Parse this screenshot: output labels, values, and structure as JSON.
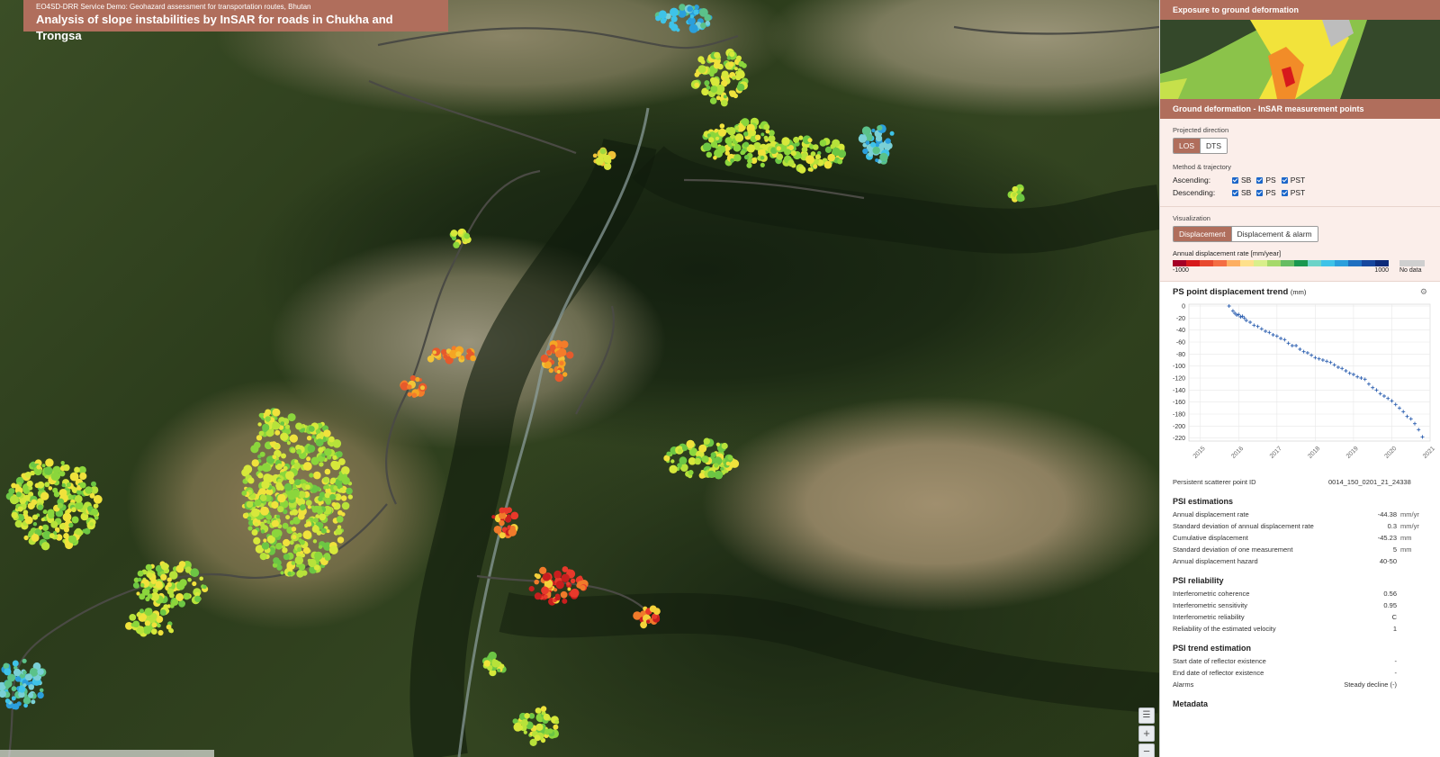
{
  "map": {
    "subtitle": "EO4SD-DRR Service Demo: Geohazard assessment for transportation routes, Bhutan",
    "title": "Analysis of slope instabilities by InSAR for roads in Chukha and Trongsa",
    "zoom_in": "+",
    "zoom_out": "−",
    "layers_icon": "layers-icon"
  },
  "panel": {
    "exposure_header": "Exposure to ground deformation",
    "deformation_header": "Ground deformation - InSAR measurement points",
    "projected_direction_label": "Projected direction",
    "direction_options": [
      "LOS",
      "DTS"
    ],
    "direction_selected": "LOS",
    "method_label": "Method & trajectory",
    "ascending_label": "Ascending:",
    "descending_label": "Descending:",
    "methods": [
      "SB",
      "PS",
      "PST"
    ],
    "visualization_label": "Visualization",
    "viz_options": [
      "Displacement",
      "Displacement & alarm"
    ],
    "viz_selected": "Displacement",
    "scale_label": "Annual displacement rate [mm/year]",
    "scale_min": "-1000",
    "scale_max": "1000",
    "no_data": "No data",
    "scale_colors": [
      "#a50026",
      "#d7191c",
      "#e8492e",
      "#f46d43",
      "#fdae61",
      "#fee08b",
      "#d9ef8b",
      "#a6d96a",
      "#66bd63",
      "#1a9850",
      "#6bd3c8",
      "#3ec3e8",
      "#2b9fdc",
      "#1f6fc0",
      "#17479e",
      "#0c2a78"
    ],
    "plot_title": "PS point displacement trend",
    "plot_unit": "(mm)",
    "plot_icon": "settings-icon"
  },
  "chart_data": {
    "type": "scatter",
    "title": "PS point displacement trend",
    "ylabel": "(mm)",
    "x_ticks": [
      "2015",
      "2016",
      "2017",
      "2018",
      "2019",
      "2020",
      "2021"
    ],
    "y_ticks": [
      0,
      -20,
      -40,
      -60,
      -80,
      -100,
      -120,
      -140,
      -160,
      -180,
      -200,
      -220
    ],
    "xlim": [
      2014.7,
      2021.0
    ],
    "ylim": [
      -225,
      3
    ],
    "x": [
      2015.75,
      2015.85,
      2015.9,
      2015.95,
      2016.0,
      2016.05,
      2016.1,
      2016.15,
      2016.2,
      2016.3,
      2016.4,
      2016.5,
      2016.6,
      2016.7,
      2016.8,
      2016.9,
      2017.0,
      2017.1,
      2017.2,
      2017.3,
      2017.4,
      2017.5,
      2017.6,
      2017.7,
      2017.8,
      2017.9,
      2018.0,
      2018.1,
      2018.2,
      2018.3,
      2018.4,
      2018.5,
      2018.6,
      2018.7,
      2018.8,
      2018.9,
      2019.0,
      2019.1,
      2019.2,
      2019.3,
      2019.4,
      2019.5,
      2019.6,
      2019.7,
      2019.8,
      2019.9,
      2020.0,
      2020.1,
      2020.2,
      2020.3,
      2020.4,
      2020.5,
      2020.6,
      2020.7,
      2020.8
    ],
    "y": [
      0,
      -8,
      -12,
      -15,
      -14,
      -18,
      -17,
      -20,
      -24,
      -27,
      -32,
      -34,
      -38,
      -42,
      -44,
      -48,
      -50,
      -54,
      -56,
      -62,
      -66,
      -66,
      -72,
      -76,
      -78,
      -82,
      -86,
      -88,
      -90,
      -92,
      -94,
      -98,
      -102,
      -104,
      -108,
      -112,
      -114,
      -118,
      -120,
      -122,
      -130,
      -136,
      -140,
      -146,
      -150,
      -154,
      -158,
      -164,
      -170,
      -176,
      -184,
      -188,
      -196,
      -206,
      -218
    ]
  },
  "ps_info": {
    "id_label": "Persistent scatterer point ID",
    "id_value": "0014_150_0201_21_24338"
  },
  "psi_estimations": {
    "title": "PSI estimations",
    "rows": [
      {
        "k": "Annual displacement rate",
        "v": "-44.38",
        "u": "mm/yr"
      },
      {
        "k": "Standard deviation of annual displacement rate",
        "v": "0.3",
        "u": "mm/yr"
      },
      {
        "k": "Cumulative displacement",
        "v": "-45.23",
        "u": "mm"
      },
      {
        "k": "Standard deviation of one measurement",
        "v": "5",
        "u": "mm"
      },
      {
        "k": "Annual displacement hazard",
        "v": "40-50",
        "u": ""
      }
    ]
  },
  "psi_reliability": {
    "title": "PSI reliability",
    "rows": [
      {
        "k": "Interferometric coherence",
        "v": "0.56",
        "u": ""
      },
      {
        "k": "Interferometric sensitivity",
        "v": "0.95",
        "u": ""
      },
      {
        "k": "Interferometric reliability",
        "v": "C",
        "u": ""
      },
      {
        "k": "Reliability of the estimated velocity",
        "v": "1",
        "u": ""
      }
    ]
  },
  "psi_trend": {
    "title": "PSI trend estimation",
    "rows": [
      {
        "k": "Start date of reflector existence",
        "v": "-",
        "u": ""
      },
      {
        "k": "End date of reflector existence",
        "v": "-",
        "u": ""
      },
      {
        "k": "Alarms",
        "v": "Steady decline (-)",
        "u": ""
      }
    ]
  },
  "metadata": {
    "title": "Metadata"
  }
}
